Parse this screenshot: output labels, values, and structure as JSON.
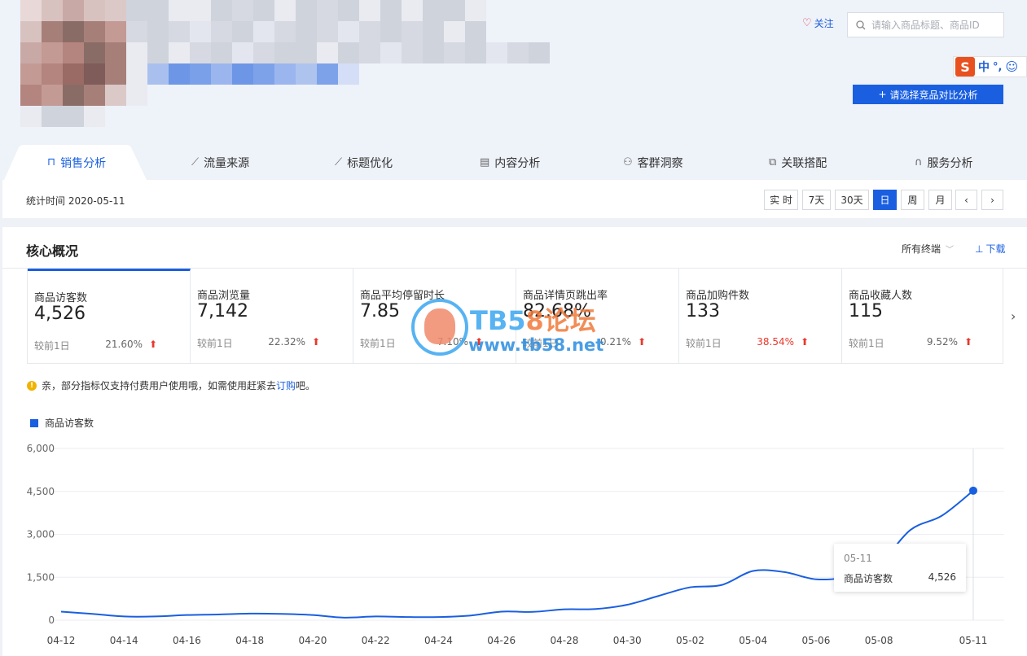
{
  "header": {
    "follow_label": "关注",
    "search_placeholder": "请输入商品标题、商品ID",
    "compare_button": "请选择竞品对比分析",
    "ime": {
      "zh": "中",
      "punct": "°,",
      "smile": "☺"
    }
  },
  "tabs": [
    {
      "label": "销售分析",
      "icon": "bag-icon",
      "active": true
    },
    {
      "label": "流量来源",
      "icon": "line-chart-icon"
    },
    {
      "label": "标题优化",
      "icon": "trend-icon"
    },
    {
      "label": "内容分析",
      "icon": "document-icon"
    },
    {
      "label": "客群洞察",
      "icon": "users-icon"
    },
    {
      "label": "关联搭配",
      "icon": "link-icon"
    },
    {
      "label": "服务分析",
      "icon": "headset-icon"
    }
  ],
  "timebar": {
    "stat_time": "统计时间 2020-05-11",
    "periods": [
      "实 时",
      "7天",
      "30天",
      "日",
      "周",
      "月"
    ],
    "active_period": "日",
    "prev": "‹",
    "next": "›"
  },
  "core": {
    "title": "核心概况",
    "terminals": "所有终端",
    "download": "下载",
    "compare_label": "较前1日",
    "metrics": [
      {
        "name": "商品访客数",
        "value": "4,526",
        "change": "21.60%",
        "red": false
      },
      {
        "name": "商品浏览量",
        "value": "7,142",
        "change": "22.32%",
        "red": false
      },
      {
        "name": "商品平均停留时长",
        "value": "7.85",
        "change": "7.10%",
        "red": false
      },
      {
        "name": "商品详情页跳出率",
        "value": "82.68%",
        "change": "0.21%",
        "red": false
      },
      {
        "name": "商品加购件数",
        "value": "133",
        "change": "38.54%",
        "red": true
      },
      {
        "name": "商品收藏人数",
        "value": "115",
        "change": "9.52%",
        "red": false
      }
    ],
    "notice": {
      "text": "亲，部分指标仅支持付费用户使用哦，如需使用赶紧去",
      "link": "订购",
      "tail": "吧。"
    }
  },
  "watermark": {
    "t1a": "TB5",
    "t1b": "8论坛",
    "t2": "www.tb58.net"
  },
  "chart_data": {
    "type": "line",
    "series": [
      {
        "name": "商品访客数",
        "x": [
          "04-12",
          "04-13",
          "04-14",
          "04-15",
          "04-16",
          "04-17",
          "04-18",
          "04-19",
          "04-20",
          "04-21",
          "04-22",
          "04-23",
          "04-24",
          "04-25",
          "04-26",
          "04-27",
          "04-28",
          "04-29",
          "04-30",
          "05-01",
          "05-02",
          "05-03",
          "05-04",
          "05-05",
          "05-06",
          "05-07",
          "05-08",
          "05-09",
          "05-10",
          "05-11"
        ],
        "values": [
          300,
          220,
          130,
          130,
          180,
          200,
          230,
          220,
          180,
          90,
          130,
          110,
          110,
          160,
          300,
          290,
          380,
          390,
          540,
          850,
          1150,
          1230,
          1720,
          1680,
          1430,
          1520,
          1950,
          3150,
          3650,
          4526
        ],
        "color": "#1a5fe0"
      }
    ],
    "x_tick_labels": [
      "04-12",
      "04-14",
      "04-16",
      "04-18",
      "04-20",
      "04-22",
      "04-24",
      "04-26",
      "04-28",
      "04-30",
      "05-02",
      "05-04",
      "05-06",
      "05-08",
      "05-11"
    ],
    "y_ticks": [
      0,
      1500,
      3000,
      4500,
      6000
    ],
    "y_tick_labels": [
      "0",
      "1,500",
      "3,000",
      "4,500",
      "6,000"
    ],
    "ylim": [
      0,
      6000
    ],
    "grid": true,
    "legend": "top-left",
    "tooltip": {
      "date": "05-11",
      "name": "商品访客数",
      "value": "4,526"
    }
  }
}
